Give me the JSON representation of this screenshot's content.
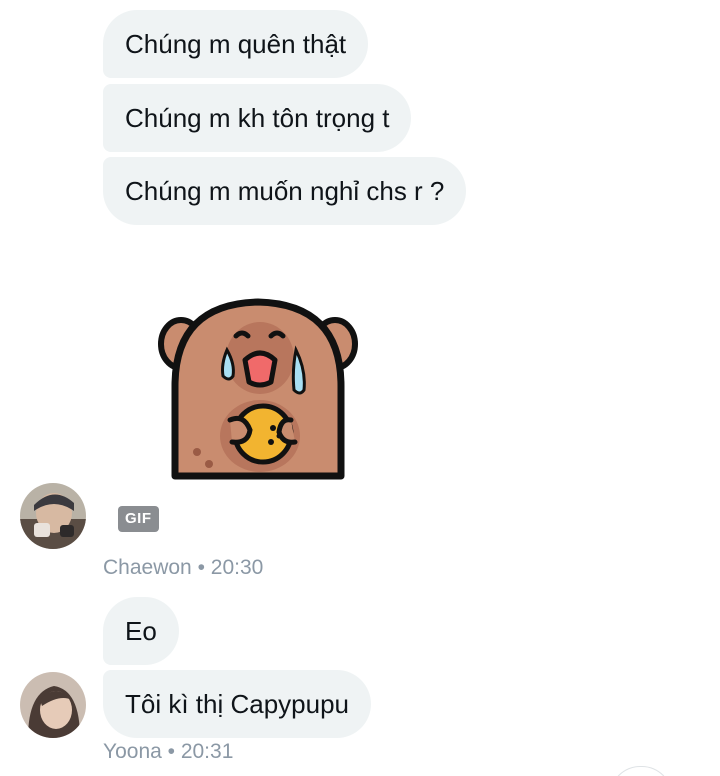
{
  "messages": [
    {
      "text": "Chúng m quên thật"
    },
    {
      "text": "Chúng m kh tôn trọng t"
    },
    {
      "text": "Chúng m muốn nghỉ chs r ?"
    },
    {
      "text": "Eo"
    },
    {
      "text": "Tôi kì thị Capypupu"
    }
  ],
  "gif": {
    "badge": "GIF",
    "sticker": "crying-capybara-holding-cookie"
  },
  "meta1": {
    "sender": "Chaewon",
    "sep": " • ",
    "time": "20:30"
  },
  "meta2": {
    "sender": "Yoona",
    "sep": " • ",
    "time": "20:31"
  },
  "colors": {
    "bubble_bg": "#eff3f4",
    "text": "#0f1419",
    "meta_text": "#8b98a5",
    "gif_badge_bg": "#8a8d91"
  }
}
